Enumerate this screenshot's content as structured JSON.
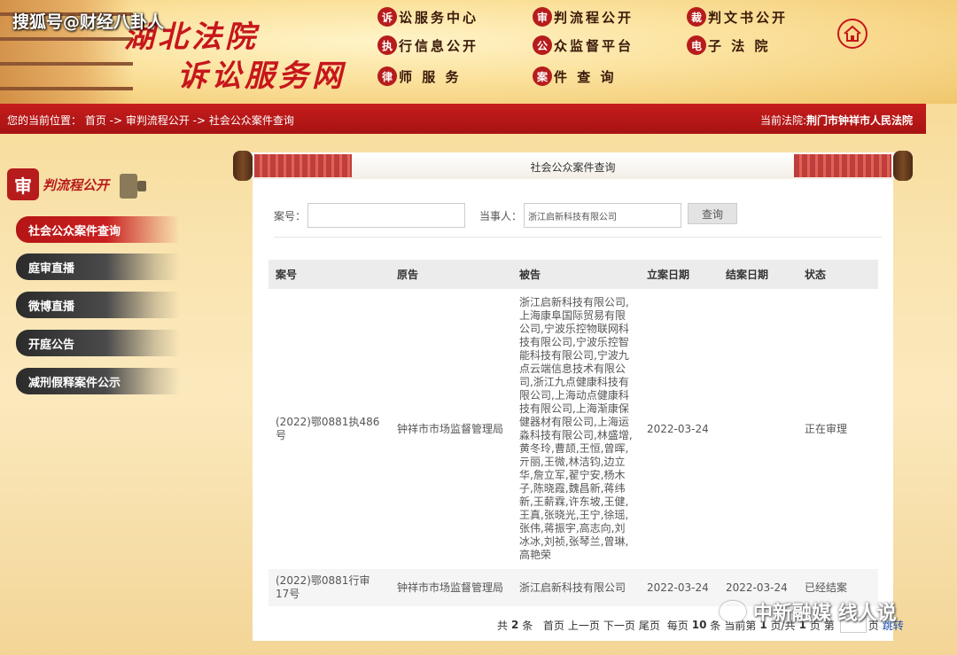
{
  "watermark_top": "搜狐号@财经八卦人",
  "site": {
    "logo_line1": "湖北法院",
    "logo_line2": "诉讼服务网"
  },
  "nav": [
    {
      "badge": "诉",
      "label": "讼服务中心"
    },
    {
      "badge": "审",
      "label": "判流程公开"
    },
    {
      "badge": "裁",
      "label": "判文书公开"
    },
    {
      "badge": "执",
      "label": "行信息公开"
    },
    {
      "badge": "公",
      "label": "众监督平台"
    },
    {
      "badge": "电",
      "label": "子 法 院"
    },
    {
      "badge": "律",
      "label": "师 服 务"
    },
    {
      "badge": "案",
      "label": "件 查 询"
    }
  ],
  "breadcrumb": "您的当前位置： 首页 -> 审判流程公开 -> 社会公众案件查询",
  "current_court_label": "当前法院:",
  "current_court": "荆门市钟祥市人民法院",
  "sidebar": {
    "title_seal": "审",
    "title": "判流程公开",
    "items": [
      {
        "label": "社会公众案件查询",
        "active": true
      },
      {
        "label": "庭审直播",
        "active": false
      },
      {
        "label": "微博直播",
        "active": false
      },
      {
        "label": "开庭公告",
        "active": false
      },
      {
        "label": "减刑假释案件公示",
        "active": false
      }
    ]
  },
  "panel_title": "社会公众案件查询",
  "search": {
    "case_label": "案号：",
    "case_value": "",
    "party_label": "当事人：",
    "party_value": "浙江启新科技有限公司",
    "query_button": "查询"
  },
  "table": {
    "headers": [
      "案号",
      "原告",
      "被告",
      "立案日期",
      "结案日期",
      "状态"
    ],
    "rows": [
      {
        "case_no": "(2022)鄂0881执486号",
        "plaintiff": "钟祥市市场监督管理局",
        "defendant": "浙江启新科技有限公司,上海康阜国际贸易有限公司,宁波乐控物联网科技有限公司,宁波乐控智能科技有限公司,宁波九点云端信息技术有限公司,浙江九点健康科技有限公司,上海动点健康科技有限公司,上海渐康保健器材有限公司,上海运淼科技有限公司,林盛增,黄冬玲,曹颉,王恒,曾晖,亓丽,王微,林洁钧,边立华,詹立军,翟宁安,杨木子,陈晓霞,魏昌新,蒋纬新,王薪霖,许东坡,王健,王真,张晓光,王宁,徐瑶,张伟,蒋振宇,高志向,刘冰冰,刘祯,张琴兰,曾琳,高艳荣",
        "filed": "2022-03-24",
        "closed": "",
        "status": "正在审理"
      },
      {
        "case_no": "(2022)鄂0881行审17号",
        "plaintiff": "钟祥市市场监督管理局",
        "defendant": "浙江启新科技有限公司",
        "filed": "2022-03-24",
        "closed": "2022-03-24",
        "status": "已经结案"
      }
    ]
  },
  "pager": {
    "total_prefix": "共",
    "total": "2",
    "total_suffix": "条",
    "first": "首页",
    "prev": "上一页",
    "next": "下一页",
    "last": "尾页",
    "per_page_prefix": "每页",
    "per_page": "10",
    "per_page_suffix": "条",
    "current_prefix": "当前第",
    "current": "1",
    "current_suffix": "页/共",
    "pages": "1",
    "pages_suffix": "页",
    "goto_prefix": "第",
    "goto_suffix": "页",
    "go": "跳转"
  },
  "watermark_bottom": "中新融媒 线人说"
}
